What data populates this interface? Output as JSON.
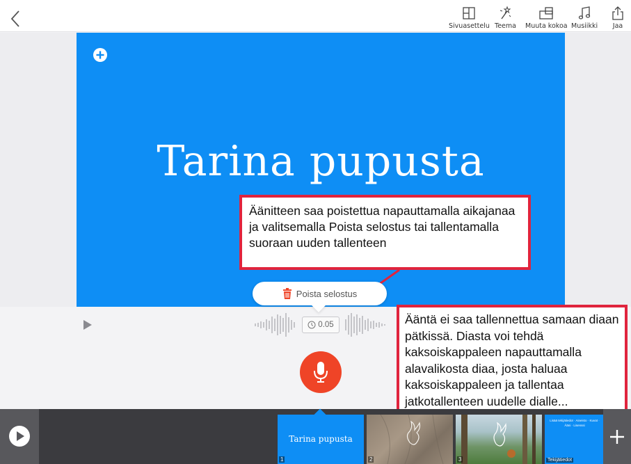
{
  "toolbar": {
    "items": [
      {
        "label": "Sivuasettelu",
        "icon": "layout-icon"
      },
      {
        "label": "Teema",
        "icon": "magic-wand-icon"
      },
      {
        "label": "Muuta kokoa",
        "icon": "resize-icon"
      },
      {
        "label": "Musiikki",
        "icon": "music-note-icon"
      },
      {
        "label": "Jaa",
        "icon": "share-icon"
      }
    ]
  },
  "slide": {
    "title": "Tarina pupusta",
    "background": "#0e8ef5"
  },
  "annotations": {
    "note1": "Äänitteen saa poistettua napauttamalla aikajanaa ja valitsemalla Poista selostus tai tallentamalla suoraan uuden tallenteen",
    "note2": "Ääntä ei saa tallennettua samaan diaan pätkissä. Diasta voi tehdä kaksoiskappaleen napauttamalla alavalikosta diaa, josta haluaa kaksoiskappaleen ja tallentaa jatkotallenteen uudelle dialle...",
    "border_color": "#e0243d"
  },
  "voice": {
    "delete_label": "Poista selostus",
    "duration": "0.05",
    "record_color": "#ef4427"
  },
  "thumbnails": [
    {
      "num": "1",
      "title": "Tarina pupusta"
    },
    {
      "num": "2"
    },
    {
      "num": "3"
    },
    {
      "label": "Tekijätiedot",
      "credits": "Lisää tekijätiedot · Aineisto · Kuvat · Ääni · Lisenssi"
    }
  ]
}
